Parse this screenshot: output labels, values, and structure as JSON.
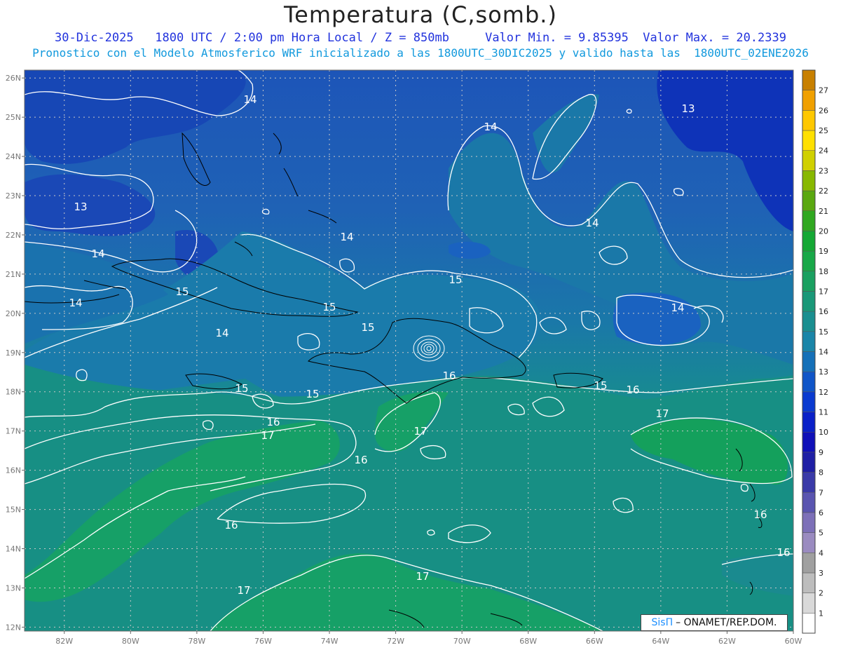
{
  "header": {
    "title": "Temperatura (C,somb.)",
    "subtitle_line1": "30-Dic-2025   1800 UTC / 2:00 pm Hora Local / Z = 850mb     Valor Min. = 9.85395  Valor Max. = 20.2339",
    "subtitle_line2": "Pronostico con el Modelo Atmosferico WRF inicializado a las 1800UTC_30DIC2025 y valido hasta las  1800UTC_02ENE2026"
  },
  "map": {
    "lat_labels": [
      "26N",
      "25N",
      "24N",
      "23N",
      "22N",
      "21N",
      "20N",
      "19N",
      "18N",
      "17N",
      "16N",
      "15N",
      "14N",
      "13N",
      "12N"
    ],
    "lon_labels": [
      "82W",
      "80W",
      "78W",
      "76W",
      "74W",
      "72W",
      "70W",
      "68W",
      "66W",
      "64W",
      "62W",
      "60W"
    ],
    "contour_labels": [
      {
        "text": "14",
        "name": "contour-label-14-a"
      },
      {
        "text": "14",
        "name": "contour-label-14-b"
      },
      {
        "text": "13",
        "name": "contour-label-13-a"
      },
      {
        "text": "13",
        "name": "contour-label-13-b"
      },
      {
        "text": "14",
        "name": "contour-label-14-c"
      },
      {
        "text": "14",
        "name": "contour-label-14-d"
      },
      {
        "text": "14",
        "name": "contour-label-14-e"
      },
      {
        "text": "14",
        "name": "contour-label-14-f"
      },
      {
        "text": "14",
        "name": "contour-label-14-g"
      },
      {
        "text": "15",
        "name": "contour-label-15-a"
      },
      {
        "text": "15",
        "name": "contour-label-15-b"
      },
      {
        "text": "15",
        "name": "contour-label-15-c"
      },
      {
        "text": "15",
        "name": "contour-label-15-d"
      },
      {
        "text": "15",
        "name": "contour-label-15-e"
      },
      {
        "text": "15",
        "name": "contour-label-15-f"
      },
      {
        "text": "15",
        "name": "contour-label-15-g"
      },
      {
        "text": "14",
        "name": "contour-label-14-h"
      },
      {
        "text": "16",
        "name": "contour-label-16-a"
      },
      {
        "text": "16",
        "name": "contour-label-16-b"
      },
      {
        "text": "16",
        "name": "contour-label-16-c"
      },
      {
        "text": "16",
        "name": "contour-label-16-d"
      },
      {
        "text": "16",
        "name": "contour-label-16-e"
      },
      {
        "text": "17",
        "name": "contour-label-17-a"
      },
      {
        "text": "17",
        "name": "contour-label-17-b"
      },
      {
        "text": "17",
        "name": "contour-label-17-c"
      },
      {
        "text": "17",
        "name": "contour-label-17-d"
      },
      {
        "text": "17",
        "name": "contour-label-17-e"
      },
      {
        "text": "16",
        "name": "contour-label-16-f"
      },
      {
        "text": "16",
        "name": "contour-label-16-g"
      }
    ]
  },
  "colorbar": {
    "labels": [
      "1",
      "2",
      "3",
      "4",
      "5",
      "6",
      "7",
      "8",
      "9",
      "10",
      "11",
      "12",
      "13",
      "14",
      "15",
      "16",
      "17",
      "18",
      "19",
      "20",
      "21",
      "22",
      "23",
      "24",
      "25",
      "26",
      "27"
    ],
    "colors": [
      "#ffffff",
      "#d9d9d9",
      "#bdbdbd",
      "#a0a0a0",
      "#9a8bc0",
      "#7d70b8",
      "#5a55b0",
      "#3a3aa8",
      "#1f1fa5",
      "#1010b8",
      "#0a20c8",
      "#0a3ad0",
      "#1055c8",
      "#1570b8",
      "#1a85a8",
      "#1a8f90",
      "#1a9878",
      "#1aa060",
      "#18a848",
      "#14a834",
      "#30a820",
      "#5aa810",
      "#88b800",
      "#d0d000",
      "#ffe000",
      "#ffc800",
      "#f0a000",
      "#c88000"
    ],
    "colors_desc": "Colorbar fill colors from lowest (bottom) to highest (top)"
  },
  "credit": {
    "brand": "SisΠ",
    "text": "– ONAMET/REP.DOM."
  }
}
